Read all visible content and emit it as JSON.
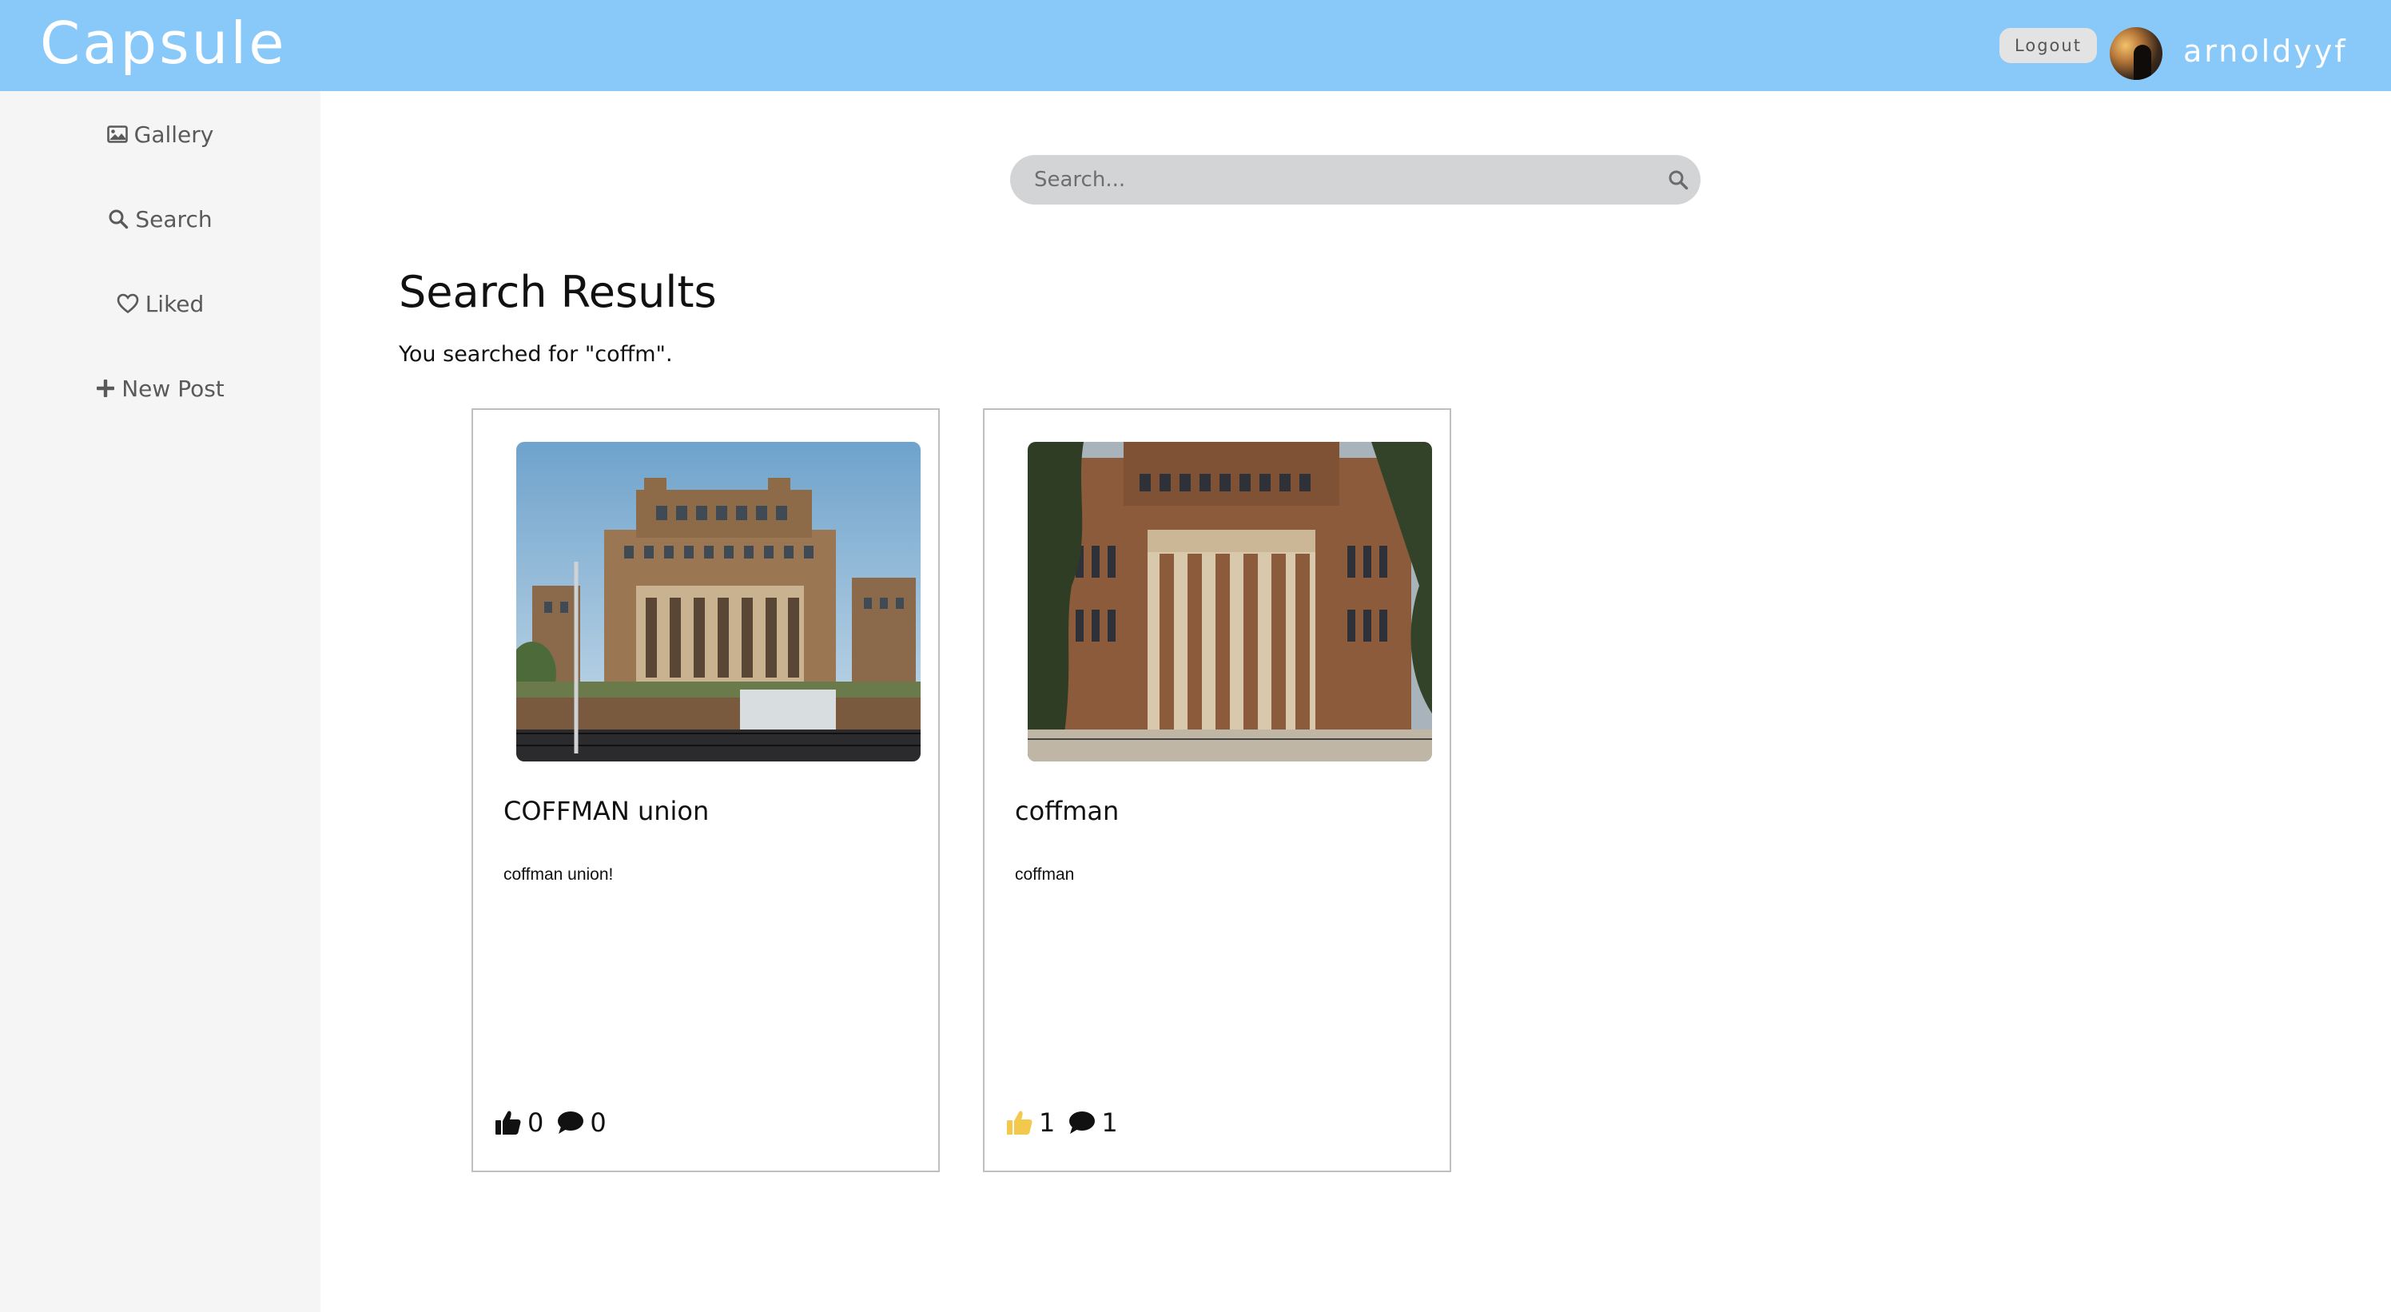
{
  "header": {
    "brand": "Capsule",
    "logout_label": "Logout",
    "username": "arnoldyyf",
    "background_color": "#88c9f9"
  },
  "sidebar": {
    "items": [
      {
        "label": "Gallery",
        "icon": "image-icon"
      },
      {
        "label": "Search",
        "icon": "search-icon"
      },
      {
        "label": "Liked",
        "icon": "heart-icon"
      },
      {
        "label": "New Post",
        "icon": "plus-icon"
      }
    ]
  },
  "search": {
    "placeholder": "Search...",
    "value": ""
  },
  "results": {
    "title": "Search Results",
    "query_text": "You searched for \"coffm\".",
    "cards": [
      {
        "title": "COFFMAN union",
        "description": "coffman union!",
        "likes": "0",
        "comments": "0",
        "liked": false,
        "like_color": "#111111"
      },
      {
        "title": "coffman",
        "description": "coffman",
        "likes": "1",
        "comments": "1",
        "liked": true,
        "like_color": "#f2c94c"
      }
    ]
  }
}
